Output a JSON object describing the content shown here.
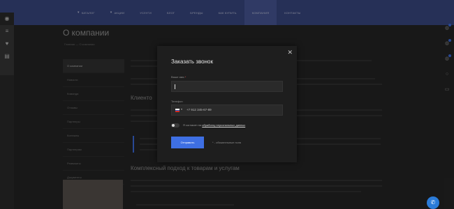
{
  "nav": {
    "items": [
      {
        "label": "Каталог",
        "chevron": true
      },
      {
        "label": "Акции",
        "chevron": true
      },
      {
        "label": "Услуги"
      },
      {
        "label": "Блог"
      },
      {
        "label": "Бренды"
      },
      {
        "label": "Как купить"
      },
      {
        "label": "Компания",
        "active": true
      },
      {
        "label": "Контакты"
      }
    ]
  },
  "page": {
    "title": "О компании",
    "breadcrumb": "Главная — О компании",
    "menu": [
      "О компании",
      "Новости",
      "Команда",
      "Отзывы",
      "Партнеры",
      "Контакты",
      "Партнерам",
      "Реквизиты",
      "Документы"
    ],
    "heading1": "Клиенто",
    "heading2": "Комплексный подход к товарам и услугам"
  },
  "modal": {
    "title": "Заказать звонок",
    "name_label": "Ваше имя",
    "required_mark": "*",
    "phone_label": "Телефон",
    "phone_placeholder": "+7 912 345-67-89",
    "consent_text": "Я согласен на ",
    "consent_link": "обработку персональных данных",
    "submit_label": "Отправить",
    "required_note": "* - обязательные поля",
    "close_glyph": "✕"
  },
  "colors": {
    "accent": "#3e6fe3",
    "nav_bg": "#3b4b86",
    "modal_bg": "#1e1e1e"
  }
}
